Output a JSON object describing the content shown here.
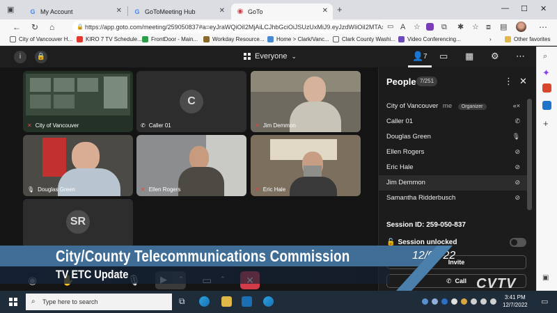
{
  "browser": {
    "tabs": [
      {
        "label": "My Account",
        "icon": "G"
      },
      {
        "label": "GoToMeeting Hub",
        "icon": "G"
      },
      {
        "label": "GoTo",
        "icon": "goto-icon"
      }
    ],
    "url": "https://app.goto.com/meeting/259050837#a=eyJraWQiOiI2MjAiLCJhbGciOiJSUzUxMiJ9.eyJzdWIiOiI2MTAxM...",
    "bookmarks": [
      "City of Vancouver H...",
      "KIRO 7 TV Schedule...",
      "FrontDoor - Main...",
      "Workday Resource...",
      "Home > Clark/Vanc...",
      "Clark County Washi...",
      "Video Conferencing..."
    ],
    "bookmarks_other": "Other favorites"
  },
  "meeting": {
    "view_label": "Everyone",
    "people_count_top": "7",
    "tiles": [
      {
        "name": "City of Vancouver",
        "mic": "none"
      },
      {
        "name": "Caller 01",
        "mic": "phone",
        "avatar": "C"
      },
      {
        "name": "Jim Demmon",
        "mic": "muted"
      },
      {
        "name": "Douglas Green",
        "mic": "on"
      },
      {
        "name": "Ellen Rogers",
        "mic": "muted"
      },
      {
        "name": "Eric Hale",
        "mic": "muted"
      },
      {
        "name": "",
        "mic": "none",
        "avatar": "SR"
      }
    ]
  },
  "people_panel": {
    "title": "People",
    "badge": "7/251",
    "participants": [
      {
        "name": "City of Vancouver",
        "me": "me",
        "role": "Organizer",
        "status": "«×"
      },
      {
        "name": "Caller 01",
        "status": "✆"
      },
      {
        "name": "Douglas Green",
        "status": "🎙"
      },
      {
        "name": "Ellen Rogers",
        "status": "⊘"
      },
      {
        "name": "Eric Hale",
        "status": "⊘"
      },
      {
        "name": "Jim Demmon",
        "status": "⊘"
      },
      {
        "name": "Samantha Ridderbusch",
        "status": "⊘"
      }
    ],
    "session_id": "Session ID: 259-050-837",
    "session_lock": "Session unlocked",
    "invite_label": "Invite",
    "call_label": "Call"
  },
  "overlay": {
    "title": "City/County Telecommunications Commission",
    "subtitle": "TV ETC Update",
    "date": "12/07/22",
    "logo": "CVTV"
  },
  "taskbar": {
    "search_placeholder": "Type here to search",
    "time": "3:41 PM",
    "date": "12/7/2022"
  },
  "colors": {
    "accent_blue": "#3f6d95",
    "leave_red": "#d33b48",
    "app_bg": "#141414"
  }
}
